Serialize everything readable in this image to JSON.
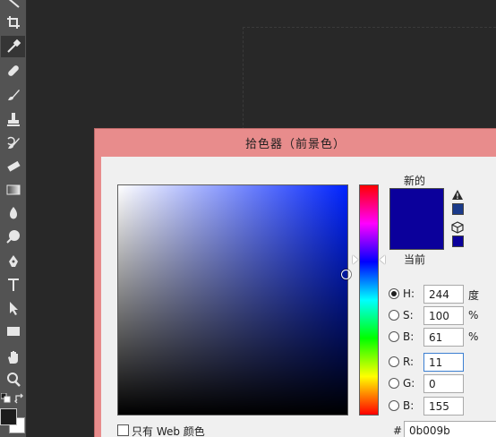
{
  "dialog": {
    "title": "拾色器（前景色）",
    "new_label": "新的",
    "current_label": "当前",
    "new_color": "#0b009b",
    "current_color": "#0b009b",
    "web_only_label": "只有 Web 颜色",
    "web_only_checked": false,
    "hex_prefix": "#",
    "hex_value": "0b009b",
    "hue_color": "#0023ff",
    "hsb": [
      {
        "label": "H:",
        "value": "244",
        "unit": "度",
        "checked": true
      },
      {
        "label": "S:",
        "value": "100",
        "unit": "%",
        "checked": false
      },
      {
        "label": "B:",
        "value": "61",
        "unit": "%",
        "checked": false
      }
    ],
    "rgb": [
      {
        "label": "R:",
        "value": "11",
        "checked": false
      },
      {
        "label": "G:",
        "value": "0",
        "checked": false
      },
      {
        "label": "B:",
        "value": "155",
        "checked": false
      }
    ]
  },
  "toolbar": {
    "tools": [
      "line-tool",
      "crop-tool",
      "eyedropper-tool",
      "healing-brush-tool",
      "brush-tool",
      "clone-stamp-tool",
      "history-brush-tool",
      "eraser-tool",
      "gradient-tool",
      "blur-tool",
      "dodge-tool",
      "pen-tool",
      "type-tool",
      "path-selection-tool",
      "rectangle-tool",
      "hand-tool",
      "zoom-tool"
    ],
    "active_tool": "eyedropper-tool",
    "foreground_color": "#1c1c1c",
    "background_color": "#ffffff"
  }
}
